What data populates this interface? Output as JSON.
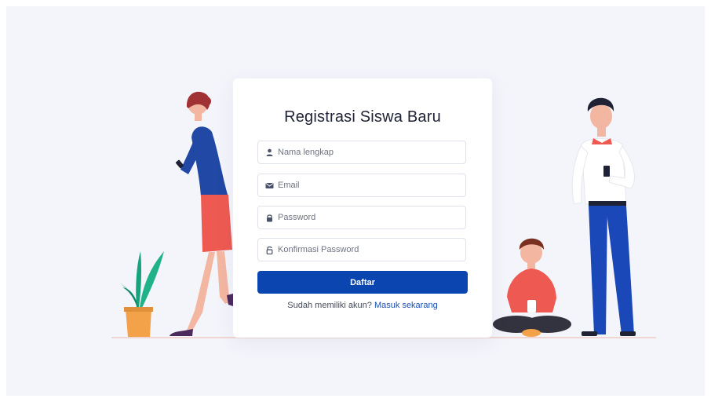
{
  "form": {
    "title": "Registrasi Siswa Baru",
    "fields": [
      {
        "icon": "user-icon",
        "placeholder": "Nama lengkap"
      },
      {
        "icon": "envelope-icon",
        "placeholder": "Email"
      },
      {
        "icon": "lock-icon",
        "placeholder": "Password"
      },
      {
        "icon": "unlock-icon",
        "placeholder": "Konfirmasi Password"
      }
    ],
    "submit_label": "Daftar",
    "login_prompt": "Sudah memiliki akun?",
    "login_link": "Masuk sekarang"
  },
  "colors": {
    "page_bg": "#f4f5fb",
    "card_bg": "#ffffff",
    "primary": "#0a45b0",
    "link": "#1b4fb0",
    "text": "#1f2235"
  }
}
